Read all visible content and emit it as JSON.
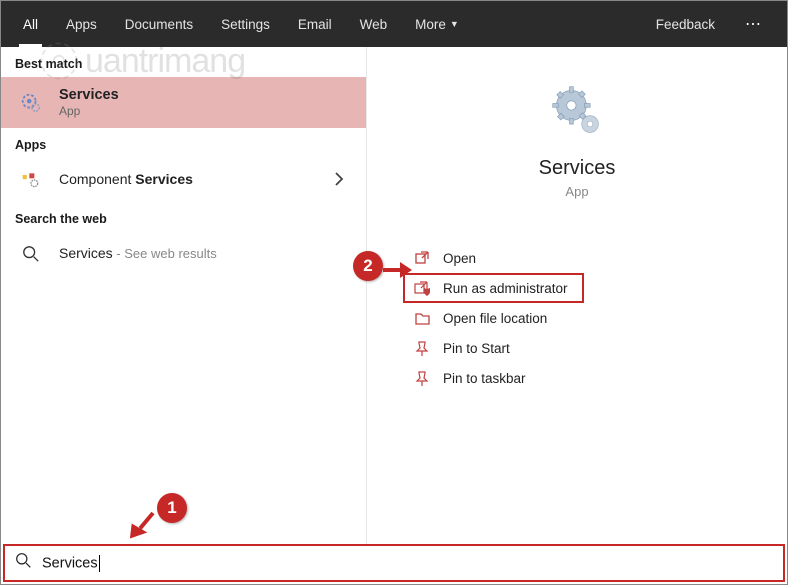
{
  "tabs": {
    "all": "All",
    "apps": "Apps",
    "documents": "Documents",
    "settings": "Settings",
    "email": "Email",
    "web": "Web",
    "more": "More",
    "feedback": "Feedback"
  },
  "left": {
    "best_match_hdr": "Best match",
    "best_match": {
      "title": "Services",
      "sub": "App"
    },
    "apps_hdr": "Apps",
    "component_pre": "Component ",
    "component_bold": "Services",
    "web_hdr": "Search the web",
    "web_services": "Services",
    "web_sub": " - See web results"
  },
  "preview": {
    "title": "Services",
    "sub": "App"
  },
  "actions": {
    "open": "Open",
    "run_admin": "Run as administrator",
    "open_loc": "Open file location",
    "pin_start": "Pin to Start",
    "pin_taskbar": "Pin to taskbar"
  },
  "search": {
    "text": "Services"
  },
  "annotations": {
    "step1": "1",
    "step2": "2"
  },
  "watermark": "uantrimang"
}
